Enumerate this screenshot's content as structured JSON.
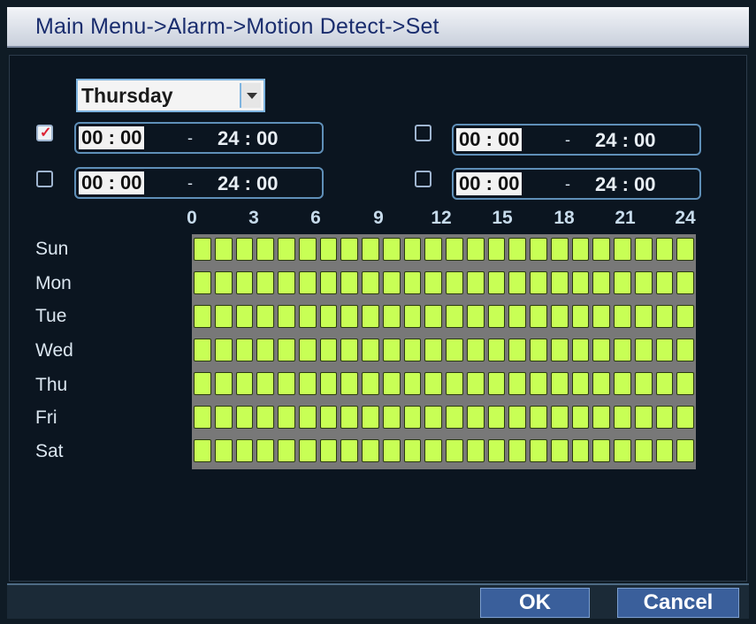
{
  "title": "Main Menu->Alarm->Motion Detect->Set",
  "day_select": {
    "value": "Thursday"
  },
  "periods": [
    {
      "checked": true,
      "start": "00 : 00",
      "separator": "-",
      "end": "24 : 00"
    },
    {
      "checked": false,
      "start": "00 : 00",
      "separator": "-",
      "end": "24 : 00"
    },
    {
      "checked": false,
      "start": "00 : 00",
      "separator": "-",
      "end": "24 : 00"
    },
    {
      "checked": false,
      "start": "00 : 00",
      "separator": "-",
      "end": "24 : 00"
    }
  ],
  "hours": [
    "0",
    "3",
    "6",
    "9",
    "12",
    "15",
    "18",
    "21",
    "24"
  ],
  "days": [
    "Sun",
    "Mon",
    "Tue",
    "Wed",
    "Thu",
    "Fri",
    "Sat"
  ],
  "buttons": {
    "ok": "OK",
    "cancel": "Cancel"
  },
  "colors": {
    "active_cell": "#c8ff55",
    "grid_bg": "#787878",
    "title_text": "#1a2d6e"
  }
}
